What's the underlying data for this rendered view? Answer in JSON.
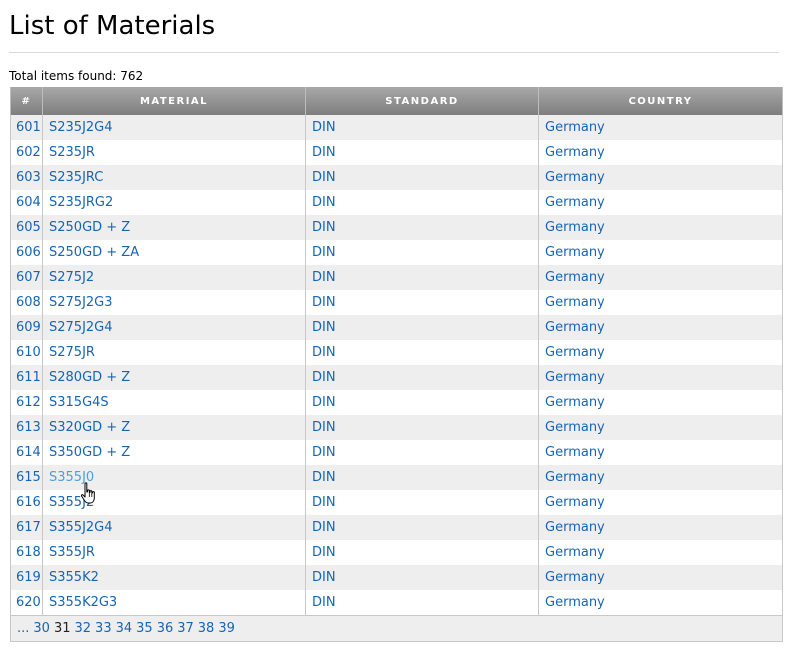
{
  "page": {
    "title": "List of Materials",
    "total": "Total items found: 762"
  },
  "table": {
    "headers": {
      "num": "#",
      "material": "MATERIAL",
      "standard": "STANDARD",
      "country": "COUNTRY"
    },
    "rows": [
      {
        "num": "601",
        "material": "S235J2G4",
        "standard": "DIN",
        "country": "Germany"
      },
      {
        "num": "602",
        "material": "S235JR",
        "standard": "DIN",
        "country": "Germany"
      },
      {
        "num": "603",
        "material": "S235JRC",
        "standard": "DIN",
        "country": "Germany"
      },
      {
        "num": "604",
        "material": "S235JRG2",
        "standard": "DIN",
        "country": "Germany"
      },
      {
        "num": "605",
        "material": "S250GD + Z",
        "standard": "DIN",
        "country": "Germany"
      },
      {
        "num": "606",
        "material": "S250GD + ZA",
        "standard": "DIN",
        "country": "Germany"
      },
      {
        "num": "607",
        "material": "S275J2",
        "standard": "DIN",
        "country": "Germany"
      },
      {
        "num": "608",
        "material": "S275J2G3",
        "standard": "DIN",
        "country": "Germany"
      },
      {
        "num": "609",
        "material": "S275J2G4",
        "standard": "DIN",
        "country": "Germany"
      },
      {
        "num": "610",
        "material": "S275JR",
        "standard": "DIN",
        "country": "Germany"
      },
      {
        "num": "611",
        "material": "S280GD + Z",
        "standard": "DIN",
        "country": "Germany"
      },
      {
        "num": "612",
        "material": "S315G4S",
        "standard": "DIN",
        "country": "Germany"
      },
      {
        "num": "613",
        "material": "S320GD + Z",
        "standard": "DIN",
        "country": "Germany"
      },
      {
        "num": "614",
        "material": "S350GD + Z",
        "standard": "DIN",
        "country": "Germany"
      },
      {
        "num": "615",
        "material": "S355J0",
        "standard": "DIN",
        "country": "Germany"
      },
      {
        "num": "616",
        "material": "S355J2",
        "standard": "DIN",
        "country": "Germany"
      },
      {
        "num": "617",
        "material": "S355J2G4",
        "standard": "DIN",
        "country": "Germany"
      },
      {
        "num": "618",
        "material": "S355JR",
        "standard": "DIN",
        "country": "Germany"
      },
      {
        "num": "619",
        "material": "S355K2",
        "standard": "DIN",
        "country": "Germany"
      },
      {
        "num": "620",
        "material": "S355K2G3",
        "standard": "DIN",
        "country": "Germany"
      }
    ]
  },
  "pagination": {
    "ellipsis": "...",
    "pages": [
      "30",
      "31",
      "32",
      "33",
      "34",
      "35",
      "36",
      "37",
      "38",
      "39"
    ],
    "current": "31"
  },
  "hovered_row": "615",
  "colors": {
    "link": "#1565b5",
    "link_hover": "#4c9fd8",
    "header_bg": "#8f8f8f",
    "row_alt": "#eeeeee"
  },
  "icons": {
    "cursor": "hand-pointer-cursor-icon"
  }
}
